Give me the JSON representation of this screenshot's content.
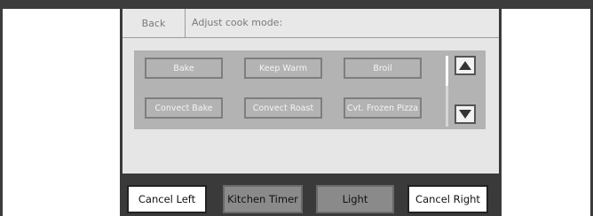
{
  "header": {
    "back_label": "Back",
    "title": "Adjust cook mode:"
  },
  "modes": {
    "items": [
      {
        "label": "Bake"
      },
      {
        "label": "Keep Warm"
      },
      {
        "label": "Broil"
      },
      {
        "label": "Convect Bake"
      },
      {
        "label": "Convect Roast"
      },
      {
        "label": "Cvt. Frozen Pizza"
      }
    ],
    "scroll_up_icon": "triangle-up",
    "scroll_down_icon": "triangle-down"
  },
  "bottom_bar": {
    "cancel_left": "Cancel Left",
    "kitchen_timer": "Kitchen Timer",
    "light": "Light",
    "cancel_right": "Cancel Right"
  },
  "colors": {
    "device_frame": "#3a3a3a",
    "screen_bg": "#e6e6e6",
    "mode_panel": "#b3b3b3",
    "mode_border": "#7e7e7e",
    "inactive_button": "#8a8a8a"
  }
}
